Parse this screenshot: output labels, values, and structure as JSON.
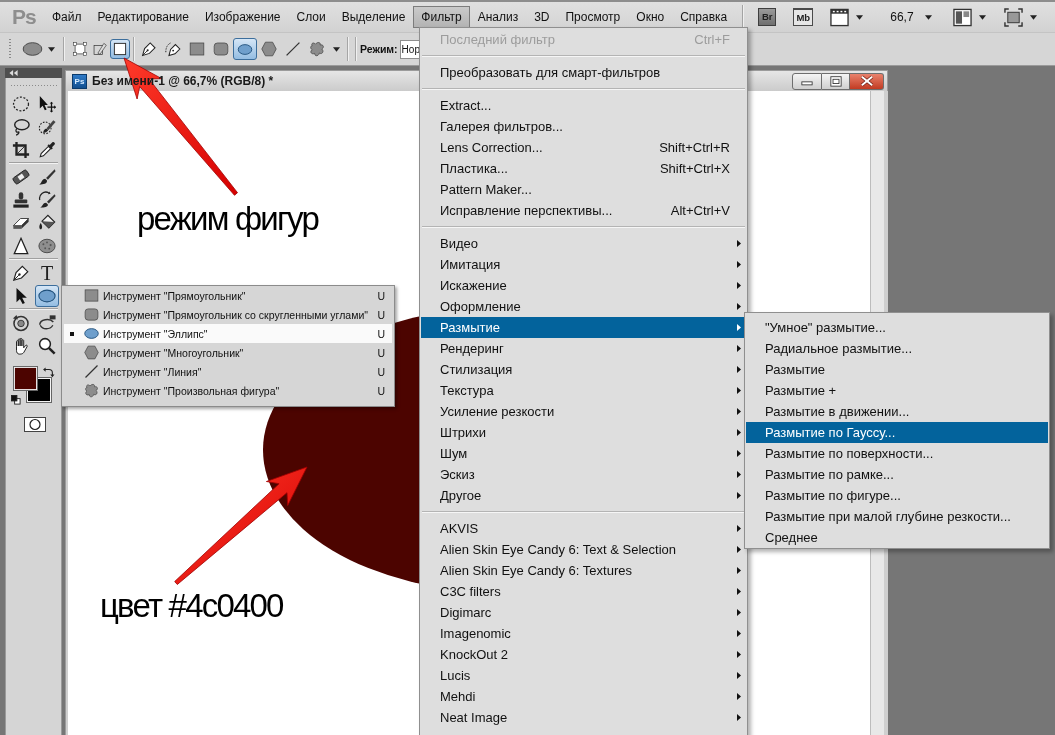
{
  "menubar": {
    "logo": "Ps",
    "menus": [
      {
        "label": "Файл",
        "selected": false
      },
      {
        "label": "Редактирование",
        "selected": false
      },
      {
        "label": "Изображение",
        "selected": false
      },
      {
        "label": "Слои",
        "selected": false
      },
      {
        "label": "Выделение",
        "selected": false
      },
      {
        "label": "Фильтр",
        "selected": true
      },
      {
        "label": "Анализ",
        "selected": false
      },
      {
        "label": "3D",
        "selected": false
      },
      {
        "label": "Просмотр",
        "selected": false
      },
      {
        "label": "Окно",
        "selected": false
      },
      {
        "label": "Справка",
        "selected": false
      }
    ],
    "launchers": [
      {
        "label": "Br"
      },
      {
        "label": "Mb"
      }
    ],
    "zoom_value": "66,7"
  },
  "options_bar": {
    "path_modes": [
      {
        "selected": false
      },
      {
        "selected": false
      },
      {
        "selected": true
      }
    ],
    "shape_tools": [
      {
        "selected": false
      },
      {
        "selected": false
      },
      {
        "selected": false
      },
      {
        "selected": false
      },
      {
        "selected": true
      },
      {
        "selected": false
      },
      {
        "selected": false
      },
      {
        "selected": false
      }
    ],
    "mode_label": "Режим:",
    "mode_value": "Нор"
  },
  "tools_panel": {
    "groups": [
      [
        {
          "selected": false
        },
        {
          "selected": false
        },
        {
          "selected": false
        },
        {
          "selected": false
        },
        {
          "selected": false
        },
        {
          "selected": false
        }
      ],
      [
        {
          "selected": false
        },
        {
          "selected": false
        },
        {
          "selected": false
        },
        {
          "selected": false
        },
        {
          "selected": false
        },
        {
          "selected": false
        },
        {
          "selected": false
        },
        {
          "selected": false
        }
      ],
      [
        {
          "selected": false
        },
        {
          "selected": false,
          "glyph": "T"
        },
        {
          "selected": false
        },
        {
          "selected": true
        }
      ],
      [
        {
          "selected": false
        },
        {
          "selected": false
        },
        {
          "selected": false
        },
        {
          "selected": false
        }
      ]
    ],
    "color_swatches": [
      {
        "kind": "foreground",
        "color": "#4c0400"
      },
      {
        "kind": "background",
        "color": "#000000"
      }
    ]
  },
  "document": {
    "icon_text": "Ps",
    "title": "Без имени-1 @ 66,7% (RGB/8) *"
  },
  "shape_flyout": {
    "items": [
      {
        "label": "Инструмент \"Прямоугольник\"",
        "shortcut": "U",
        "selected": false
      },
      {
        "label": "Инструмент \"Прямоугольник со скругленными углами\"",
        "shortcut": "U",
        "selected": false
      },
      {
        "label": "Инструмент \"Эллипс\"",
        "shortcut": "U",
        "selected": true
      },
      {
        "label": "Инструмент \"Многоугольник\"",
        "shortcut": "U",
        "selected": false
      },
      {
        "label": "Инструмент \"Линия\"",
        "shortcut": "U",
        "selected": false
      },
      {
        "label": "Инструмент \"Произвольная фигура\"",
        "shortcut": "U",
        "selected": false
      }
    ]
  },
  "filter_menu": {
    "sections": [
      [
        {
          "label": "Последний фильтр",
          "shortcut": "Ctrl+F",
          "submenu": false,
          "disabled": true,
          "selected": false
        }
      ],
      [
        {
          "label": "Преобразовать для смарт-фильтров",
          "submenu": false,
          "disabled": false,
          "selected": false
        }
      ],
      [
        {
          "label": "Extract...",
          "submenu": false,
          "disabled": false,
          "selected": false
        },
        {
          "label": "Галерея фильтров...",
          "submenu": false,
          "disabled": false,
          "selected": false
        },
        {
          "label": "Lens Correction...",
          "shortcut": "Shift+Ctrl+R",
          "submenu": false,
          "disabled": false,
          "selected": false
        },
        {
          "label": "Пластика...",
          "shortcut": "Shift+Ctrl+X",
          "submenu": false,
          "disabled": false,
          "selected": false
        },
        {
          "label": "Pattern Maker...",
          "submenu": false,
          "disabled": false,
          "selected": false
        },
        {
          "label": "Исправление перспективы...",
          "shortcut": "Alt+Ctrl+V",
          "submenu": false,
          "disabled": false,
          "selected": false
        }
      ],
      [
        {
          "label": "Видео",
          "submenu": true,
          "disabled": false,
          "selected": false
        },
        {
          "label": "Имитация",
          "submenu": true,
          "disabled": false,
          "selected": false
        },
        {
          "label": "Искажение",
          "submenu": true,
          "disabled": false,
          "selected": false
        },
        {
          "label": "Оформление",
          "submenu": true,
          "disabled": false,
          "selected": false
        },
        {
          "label": "Размытие",
          "submenu": true,
          "disabled": false,
          "selected": true
        },
        {
          "label": "Рендеринг",
          "submenu": true,
          "disabled": false,
          "selected": false
        },
        {
          "label": "Стилизация",
          "submenu": true,
          "disabled": false,
          "selected": false
        },
        {
          "label": "Текстура",
          "submenu": true,
          "disabled": false,
          "selected": false
        },
        {
          "label": "Усиление резкости",
          "submenu": true,
          "disabled": false,
          "selected": false
        },
        {
          "label": "Штрихи",
          "submenu": true,
          "disabled": false,
          "selected": false
        },
        {
          "label": "Шум",
          "submenu": true,
          "disabled": false,
          "selected": false
        },
        {
          "label": "Эскиз",
          "submenu": true,
          "disabled": false,
          "selected": false
        },
        {
          "label": "Другое",
          "submenu": true,
          "disabled": false,
          "selected": false
        }
      ],
      [
        {
          "label": "AKVIS",
          "submenu": true,
          "disabled": false,
          "selected": false
        },
        {
          "label": "Alien Skin Eye Candy 6: Text & Selection",
          "submenu": true,
          "disabled": false,
          "selected": false
        },
        {
          "label": "Alien Skin Eye Candy 6: Textures",
          "submenu": true,
          "disabled": false,
          "selected": false
        },
        {
          "label": "C3C filters",
          "submenu": true,
          "disabled": false,
          "selected": false
        },
        {
          "label": "Digimarc",
          "submenu": true,
          "disabled": false,
          "selected": false
        },
        {
          "label": "Imagenomic",
          "submenu": true,
          "disabled": false,
          "selected": false
        },
        {
          "label": "KnockOut 2",
          "submenu": true,
          "disabled": false,
          "selected": false
        },
        {
          "label": "Lucis",
          "submenu": true,
          "disabled": false,
          "selected": false
        },
        {
          "label": "Mehdi",
          "submenu": true,
          "disabled": false,
          "selected": false
        },
        {
          "label": "Neat Image",
          "submenu": true,
          "disabled": false,
          "selected": false
        }
      ]
    ]
  },
  "blur_submenu": {
    "items": [
      {
        "label": "\"Умное\" размытие...",
        "selected": false
      },
      {
        "label": "Радиальное размытие...",
        "selected": false
      },
      {
        "label": "Размытие",
        "selected": false
      },
      {
        "label": "Размытие +",
        "selected": false
      },
      {
        "label": "Размытие в движении...",
        "selected": false
      },
      {
        "label": "Размытие по Гауссу...",
        "selected": true
      },
      {
        "label": "Размытие по поверхности...",
        "selected": false
      },
      {
        "label": "Размытие по рамке...",
        "selected": false
      },
      {
        "label": "Размытие по фигуре...",
        "selected": false
      },
      {
        "label": "Размытие при малой глубине резкости...",
        "selected": false
      },
      {
        "label": "Среднее",
        "selected": false
      }
    ]
  },
  "annotations": [
    {
      "text": "режим фигур"
    },
    {
      "text": "цвет #4c0400"
    }
  ]
}
